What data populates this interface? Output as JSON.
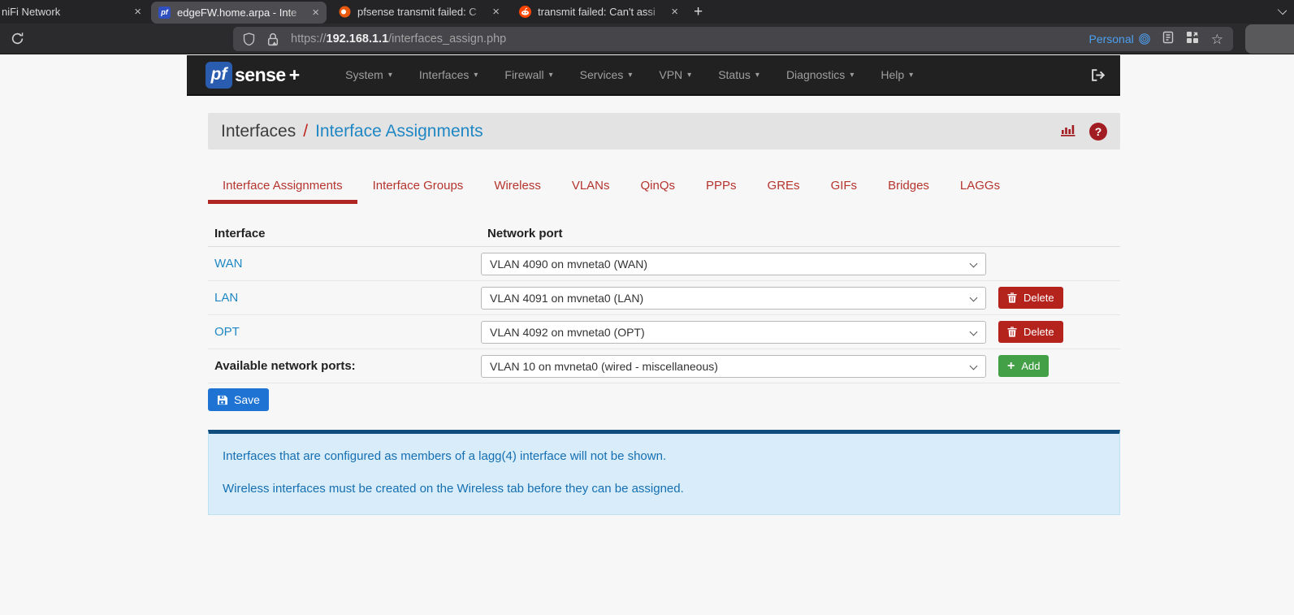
{
  "browser": {
    "tabs": [
      {
        "title": "niFi Network",
        "active": false,
        "favicon": "none"
      },
      {
        "title": "edgeFW.home.arpa - Inte",
        "active": true,
        "favicon": "pfsense"
      },
      {
        "title": "pfsense transmit failed: C",
        "active": false,
        "favicon": "netgate"
      },
      {
        "title": "transmit failed: Can't assi",
        "active": false,
        "favicon": "reddit"
      }
    ],
    "new_tab_label": "+",
    "close_label": "×",
    "url": {
      "scheme": "https://",
      "host": "192.168.1.1",
      "path": "/interfaces_assign.php"
    },
    "profile_label": "Personal",
    "star_glyph": "☆"
  },
  "navbar": {
    "logo": {
      "pf": "pf",
      "sense": "sense",
      "plus": "+"
    },
    "caret": "▾",
    "items": [
      {
        "label": "System"
      },
      {
        "label": "Interfaces"
      },
      {
        "label": "Firewall"
      },
      {
        "label": "Services"
      },
      {
        "label": "VPN"
      },
      {
        "label": "Status"
      },
      {
        "label": "Diagnostics"
      },
      {
        "label": "Help"
      }
    ]
  },
  "breadcrumb": {
    "section": "Interfaces",
    "separator": "/",
    "page": "Interface Assignments",
    "help_glyph": "?"
  },
  "page_tabs": [
    {
      "label": "Interface Assignments",
      "active": true
    },
    {
      "label": "Interface Groups",
      "active": false
    },
    {
      "label": "Wireless",
      "active": false
    },
    {
      "label": "VLANs",
      "active": false
    },
    {
      "label": "QinQs",
      "active": false
    },
    {
      "label": "PPPs",
      "active": false
    },
    {
      "label": "GREs",
      "active": false
    },
    {
      "label": "GIFs",
      "active": false
    },
    {
      "label": "Bridges",
      "active": false
    },
    {
      "label": "LAGGs",
      "active": false
    }
  ],
  "table": {
    "headers": {
      "interface": "Interface",
      "port": "Network port"
    },
    "rows": [
      {
        "interface": "WAN",
        "port": "VLAN 4090 on mvneta0 (WAN)"
      },
      {
        "interface": "LAN",
        "port": "VLAN 4091 on mvneta0 (LAN)"
      },
      {
        "interface": "OPT",
        "port": "VLAN 4092 on mvneta0 (OPT)"
      }
    ],
    "available": {
      "label": "Available network ports:",
      "port": "VLAN 10 on mvneta0 (wired - miscellaneous)"
    }
  },
  "actions": {
    "save_label": "Save",
    "add_label": "Add",
    "delete_label": "Delete"
  },
  "notes": {
    "line1": "Interfaces that are configured as members of a lagg(4) interface will not be shown.",
    "line2": "Wireless interfaces must be created on the Wireless tab before they can be assigned."
  },
  "colors": {
    "tab_red": "#b5342e",
    "underline_red": "#ae2722",
    "link_blue": "#1f87c4",
    "danger": "#b5231d",
    "success": "#43a047",
    "primary": "#1f73d2",
    "info_bg": "#d8edf9",
    "info_border_top": "#114d7c",
    "info_text": "#156fb2",
    "navbar_bg": "#212121",
    "breadcrumb_bg": "#e3e3e3",
    "icon_red": "#a21d22"
  }
}
